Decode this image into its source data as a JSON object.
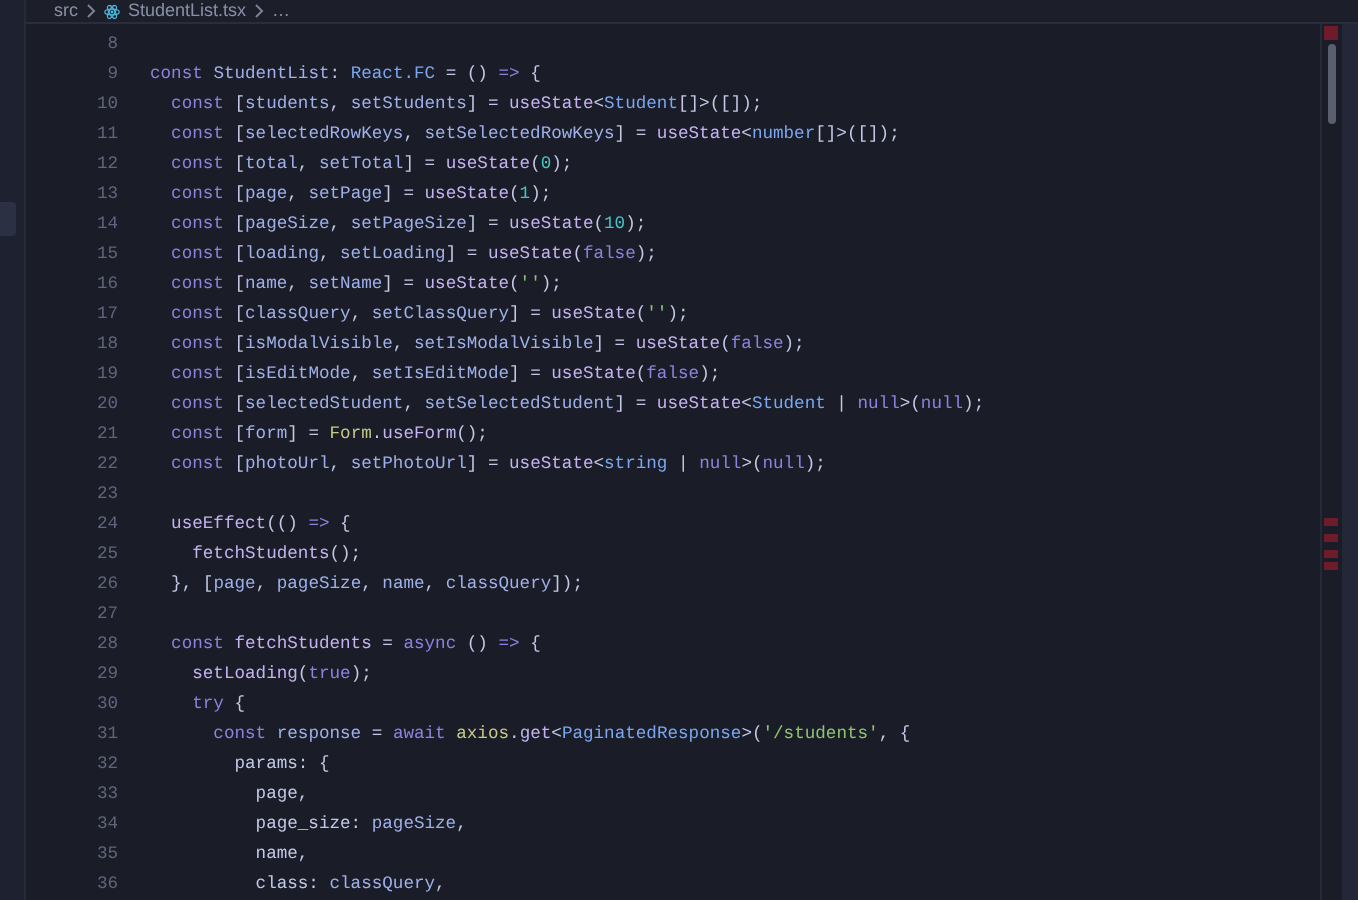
{
  "breadcrumb": {
    "folder": "src",
    "file": "StudentList.tsx",
    "more": "…"
  },
  "editor": {
    "lines": [
      {
        "number": "8"
      },
      {
        "number": "9",
        "tokens": [
          {
            "kind": "keyword",
            "text": "const "
          },
          {
            "kind": "variable",
            "text": "StudentList"
          },
          {
            "kind": "plain",
            "text": ": "
          },
          {
            "kind": "type",
            "text": "React.FC"
          },
          {
            "kind": "plain",
            "text": " = () "
          },
          {
            "kind": "keyword",
            "text": "=>"
          },
          {
            "kind": "plain",
            "text": " {"
          }
        ]
      },
      {
        "number": "10",
        "tokens": [
          {
            "kind": "keyword",
            "text": "  const "
          },
          {
            "kind": "plain",
            "text": "["
          },
          {
            "kind": "variable",
            "text": "students"
          },
          {
            "kind": "plain",
            "text": ", "
          },
          {
            "kind": "variable",
            "text": "setStudents"
          },
          {
            "kind": "plain",
            "text": "] = "
          },
          {
            "kind": "function",
            "text": "useState"
          },
          {
            "kind": "plain",
            "text": "<"
          },
          {
            "kind": "type",
            "text": "Student"
          },
          {
            "kind": "plain",
            "text": "[]>([]);"
          }
        ]
      },
      {
        "number": "11",
        "tokens": [
          {
            "kind": "keyword",
            "text": "  const "
          },
          {
            "kind": "plain",
            "text": "["
          },
          {
            "kind": "variable",
            "text": "selectedRowKeys"
          },
          {
            "kind": "plain",
            "text": ", "
          },
          {
            "kind": "variable",
            "text": "setSelectedRowKeys"
          },
          {
            "kind": "plain",
            "text": "] = "
          },
          {
            "kind": "function",
            "text": "useState"
          },
          {
            "kind": "plain",
            "text": "<"
          },
          {
            "kind": "type",
            "text": "number"
          },
          {
            "kind": "plain",
            "text": "[]>([]);"
          }
        ]
      },
      {
        "number": "12",
        "tokens": [
          {
            "kind": "keyword",
            "text": "  const "
          },
          {
            "kind": "plain",
            "text": "["
          },
          {
            "kind": "variable",
            "text": "total"
          },
          {
            "kind": "plain",
            "text": ", "
          },
          {
            "kind": "variable",
            "text": "setTotal"
          },
          {
            "kind": "plain",
            "text": "] = "
          },
          {
            "kind": "function",
            "text": "useState"
          },
          {
            "kind": "plain",
            "text": "("
          },
          {
            "kind": "number",
            "text": "0"
          },
          {
            "kind": "plain",
            "text": ");"
          }
        ]
      },
      {
        "number": "13",
        "tokens": [
          {
            "kind": "keyword",
            "text": "  const "
          },
          {
            "kind": "plain",
            "text": "["
          },
          {
            "kind": "variable",
            "text": "page"
          },
          {
            "kind": "plain",
            "text": ", "
          },
          {
            "kind": "variable",
            "text": "setPage"
          },
          {
            "kind": "plain",
            "text": "] = "
          },
          {
            "kind": "function",
            "text": "useState"
          },
          {
            "kind": "plain",
            "text": "("
          },
          {
            "kind": "number",
            "text": "1"
          },
          {
            "kind": "plain",
            "text": ");"
          }
        ]
      },
      {
        "number": "14",
        "tokens": [
          {
            "kind": "keyword",
            "text": "  const "
          },
          {
            "kind": "plain",
            "text": "["
          },
          {
            "kind": "variable",
            "text": "pageSize"
          },
          {
            "kind": "plain",
            "text": ", "
          },
          {
            "kind": "variable",
            "text": "setPageSize"
          },
          {
            "kind": "plain",
            "text": "] = "
          },
          {
            "kind": "function",
            "text": "useState"
          },
          {
            "kind": "plain",
            "text": "("
          },
          {
            "kind": "number",
            "text": "10"
          },
          {
            "kind": "plain",
            "text": ");"
          }
        ]
      },
      {
        "number": "15",
        "tokens": [
          {
            "kind": "keyword",
            "text": "  const "
          },
          {
            "kind": "plain",
            "text": "["
          },
          {
            "kind": "variable",
            "text": "loading"
          },
          {
            "kind": "plain",
            "text": ", "
          },
          {
            "kind": "variable",
            "text": "setLoading"
          },
          {
            "kind": "plain",
            "text": "] = "
          },
          {
            "kind": "function",
            "text": "useState"
          },
          {
            "kind": "plain",
            "text": "("
          },
          {
            "kind": "keyword",
            "text": "false"
          },
          {
            "kind": "plain",
            "text": ");"
          }
        ]
      },
      {
        "number": "16",
        "tokens": [
          {
            "kind": "keyword",
            "text": "  const "
          },
          {
            "kind": "plain",
            "text": "["
          },
          {
            "kind": "variable",
            "text": "name"
          },
          {
            "kind": "plain",
            "text": ", "
          },
          {
            "kind": "variable",
            "text": "setName"
          },
          {
            "kind": "plain",
            "text": "] = "
          },
          {
            "kind": "function",
            "text": "useState"
          },
          {
            "kind": "plain",
            "text": "("
          },
          {
            "kind": "string",
            "text": "''"
          },
          {
            "kind": "plain",
            "text": ");"
          }
        ]
      },
      {
        "number": "17",
        "tokens": [
          {
            "kind": "keyword",
            "text": "  const "
          },
          {
            "kind": "plain",
            "text": "["
          },
          {
            "kind": "variable",
            "text": "classQuery"
          },
          {
            "kind": "plain",
            "text": ", "
          },
          {
            "kind": "variable",
            "text": "setClassQuery"
          },
          {
            "kind": "plain",
            "text": "] = "
          },
          {
            "kind": "function",
            "text": "useState"
          },
          {
            "kind": "plain",
            "text": "("
          },
          {
            "kind": "string",
            "text": "''"
          },
          {
            "kind": "plain",
            "text": ");"
          }
        ]
      },
      {
        "number": "18",
        "tokens": [
          {
            "kind": "keyword",
            "text": "  const "
          },
          {
            "kind": "plain",
            "text": "["
          },
          {
            "kind": "variable",
            "text": "isModalVisible"
          },
          {
            "kind": "plain",
            "text": ", "
          },
          {
            "kind": "variable",
            "text": "setIsModalVisible"
          },
          {
            "kind": "plain",
            "text": "] = "
          },
          {
            "kind": "function",
            "text": "useState"
          },
          {
            "kind": "plain",
            "text": "("
          },
          {
            "kind": "keyword",
            "text": "false"
          },
          {
            "kind": "plain",
            "text": ");"
          }
        ]
      },
      {
        "number": "19",
        "tokens": [
          {
            "kind": "keyword",
            "text": "  const "
          },
          {
            "kind": "plain",
            "text": "["
          },
          {
            "kind": "variable",
            "text": "isEditMode"
          },
          {
            "kind": "plain",
            "text": ", "
          },
          {
            "kind": "variable",
            "text": "setIsEditMode"
          },
          {
            "kind": "plain",
            "text": "] = "
          },
          {
            "kind": "function",
            "text": "useState"
          },
          {
            "kind": "plain",
            "text": "("
          },
          {
            "kind": "keyword",
            "text": "false"
          },
          {
            "kind": "plain",
            "text": ");"
          }
        ]
      },
      {
        "number": "20",
        "tokens": [
          {
            "kind": "keyword",
            "text": "  const "
          },
          {
            "kind": "plain",
            "text": "["
          },
          {
            "kind": "variable",
            "text": "selectedStudent"
          },
          {
            "kind": "plain",
            "text": ", "
          },
          {
            "kind": "variable",
            "text": "setSelectedStudent"
          },
          {
            "kind": "plain",
            "text": "] = "
          },
          {
            "kind": "function",
            "text": "useState"
          },
          {
            "kind": "plain",
            "text": "<"
          },
          {
            "kind": "type",
            "text": "Student"
          },
          {
            "kind": "plain",
            "text": " | "
          },
          {
            "kind": "keyword",
            "text": "null"
          },
          {
            "kind": "plain",
            "text": ">("
          },
          {
            "kind": "keyword",
            "text": "null"
          },
          {
            "kind": "plain",
            "text": ");"
          }
        ]
      },
      {
        "number": "21",
        "tokens": [
          {
            "kind": "keyword",
            "text": "  const "
          },
          {
            "kind": "plain",
            "text": "["
          },
          {
            "kind": "variable",
            "text": "form"
          },
          {
            "kind": "plain",
            "text": "] = "
          },
          {
            "kind": "object",
            "text": "Form"
          },
          {
            "kind": "plain",
            "text": "."
          },
          {
            "kind": "function",
            "text": "useForm"
          },
          {
            "kind": "plain",
            "text": "();"
          }
        ]
      },
      {
        "number": "22",
        "tokens": [
          {
            "kind": "keyword",
            "text": "  const "
          },
          {
            "kind": "plain",
            "text": "["
          },
          {
            "kind": "variable",
            "text": "photoUrl"
          },
          {
            "kind": "plain",
            "text": ", "
          },
          {
            "kind": "variable",
            "text": "setPhotoUrl"
          },
          {
            "kind": "plain",
            "text": "] = "
          },
          {
            "kind": "function",
            "text": "useState"
          },
          {
            "kind": "plain",
            "text": "<"
          },
          {
            "kind": "type",
            "text": "string"
          },
          {
            "kind": "plain",
            "text": " | "
          },
          {
            "kind": "keyword",
            "text": "null"
          },
          {
            "kind": "plain",
            "text": ">("
          },
          {
            "kind": "keyword",
            "text": "null"
          },
          {
            "kind": "plain",
            "text": ");"
          }
        ]
      },
      {
        "number": "23"
      },
      {
        "number": "24",
        "tokens": [
          {
            "kind": "function",
            "text": "  useEffect"
          },
          {
            "kind": "plain",
            "text": "(() "
          },
          {
            "kind": "keyword",
            "text": "=>"
          },
          {
            "kind": "plain",
            "text": " {"
          }
        ]
      },
      {
        "number": "25",
        "tokens": [
          {
            "kind": "function",
            "text": "    fetchStudents"
          },
          {
            "kind": "plain",
            "text": "();"
          }
        ]
      },
      {
        "number": "26",
        "tokens": [
          {
            "kind": "plain",
            "text": "  }, ["
          },
          {
            "kind": "variable",
            "text": "page"
          },
          {
            "kind": "plain",
            "text": ", "
          },
          {
            "kind": "variable",
            "text": "pageSize"
          },
          {
            "kind": "plain",
            "text": ", "
          },
          {
            "kind": "variable",
            "text": "name"
          },
          {
            "kind": "plain",
            "text": ", "
          },
          {
            "kind": "variable",
            "text": "classQuery"
          },
          {
            "kind": "plain",
            "text": "]);"
          }
        ]
      },
      {
        "number": "27"
      },
      {
        "number": "28",
        "tokens": [
          {
            "kind": "keyword",
            "text": "  const "
          },
          {
            "kind": "function",
            "text": "fetchStudents"
          },
          {
            "kind": "plain",
            "text": " = "
          },
          {
            "kind": "keyword",
            "text": "async"
          },
          {
            "kind": "plain",
            "text": " () "
          },
          {
            "kind": "keyword",
            "text": "=>"
          },
          {
            "kind": "plain",
            "text": " {"
          }
        ]
      },
      {
        "number": "29",
        "tokens": [
          {
            "kind": "function",
            "text": "    setLoading"
          },
          {
            "kind": "plain",
            "text": "("
          },
          {
            "kind": "keyword",
            "text": "true"
          },
          {
            "kind": "plain",
            "text": ");"
          }
        ]
      },
      {
        "number": "30",
        "tokens": [
          {
            "kind": "keyword",
            "text": "    try"
          },
          {
            "kind": "plain",
            "text": " {"
          }
        ]
      },
      {
        "number": "31",
        "tokens": [
          {
            "kind": "keyword",
            "text": "      const "
          },
          {
            "kind": "variable",
            "text": "response"
          },
          {
            "kind": "plain",
            "text": " = "
          },
          {
            "kind": "keyword",
            "text": "await "
          },
          {
            "kind": "object",
            "text": "axios"
          },
          {
            "kind": "plain",
            "text": "."
          },
          {
            "kind": "function",
            "text": "get"
          },
          {
            "kind": "plain",
            "text": "<"
          },
          {
            "kind": "type",
            "text": "PaginatedResponse"
          },
          {
            "kind": "plain",
            "text": ">("
          },
          {
            "kind": "string",
            "text": "'/students'"
          },
          {
            "kind": "plain",
            "text": ", {"
          }
        ]
      },
      {
        "number": "32",
        "tokens": [
          {
            "kind": "plain",
            "text": "        params: {"
          }
        ]
      },
      {
        "number": "33",
        "tokens": [
          {
            "kind": "plain",
            "text": "          page,"
          }
        ]
      },
      {
        "number": "34",
        "tokens": [
          {
            "kind": "plain",
            "text": "          page_size: "
          },
          {
            "kind": "variable",
            "text": "pageSize"
          },
          {
            "kind": "plain",
            "text": ","
          }
        ]
      },
      {
        "number": "35",
        "tokens": [
          {
            "kind": "plain",
            "text": "          name,"
          }
        ]
      },
      {
        "number": "36",
        "tokens": [
          {
            "kind": "plain",
            "text": "          class: "
          },
          {
            "kind": "variable",
            "text": "classQuery"
          },
          {
            "kind": "plain",
            "text": ","
          }
        ]
      }
    ]
  }
}
